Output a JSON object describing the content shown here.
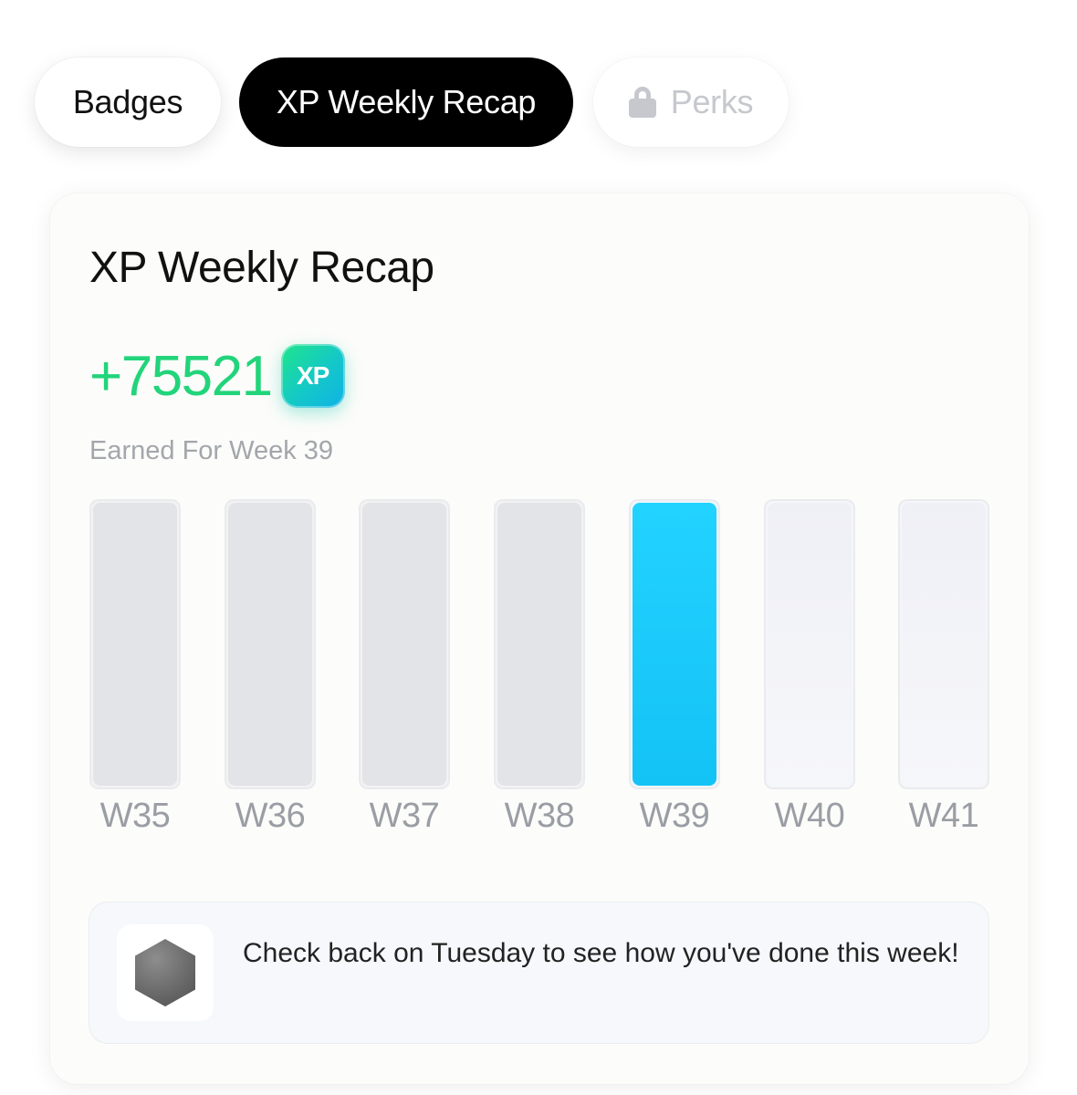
{
  "tabs": {
    "badges": "Badges",
    "recap": "XP Weekly Recap",
    "perks": "Perks"
  },
  "card": {
    "title": "XP Weekly Recap",
    "xp_amount": "+75521",
    "xp_badge_label": "XP",
    "subtitle": "Earned For Week 39"
  },
  "chart_data": {
    "type": "bar",
    "categories": [
      "W35",
      "W36",
      "W37",
      "W38",
      "W39",
      "W40",
      "W41"
    ],
    "selected": "W39",
    "status": [
      "past",
      "past",
      "past",
      "past",
      "current",
      "future",
      "future"
    ],
    "title": "",
    "xlabel": "",
    "ylabel": ""
  },
  "info": {
    "icon": "hexagon-icon",
    "text": "Check back on Tuesday to see how you've done this week!"
  },
  "colors": {
    "accent_green": "#22d47a",
    "selected_bar": "#1fc9fb",
    "active_tab": "#000000"
  }
}
